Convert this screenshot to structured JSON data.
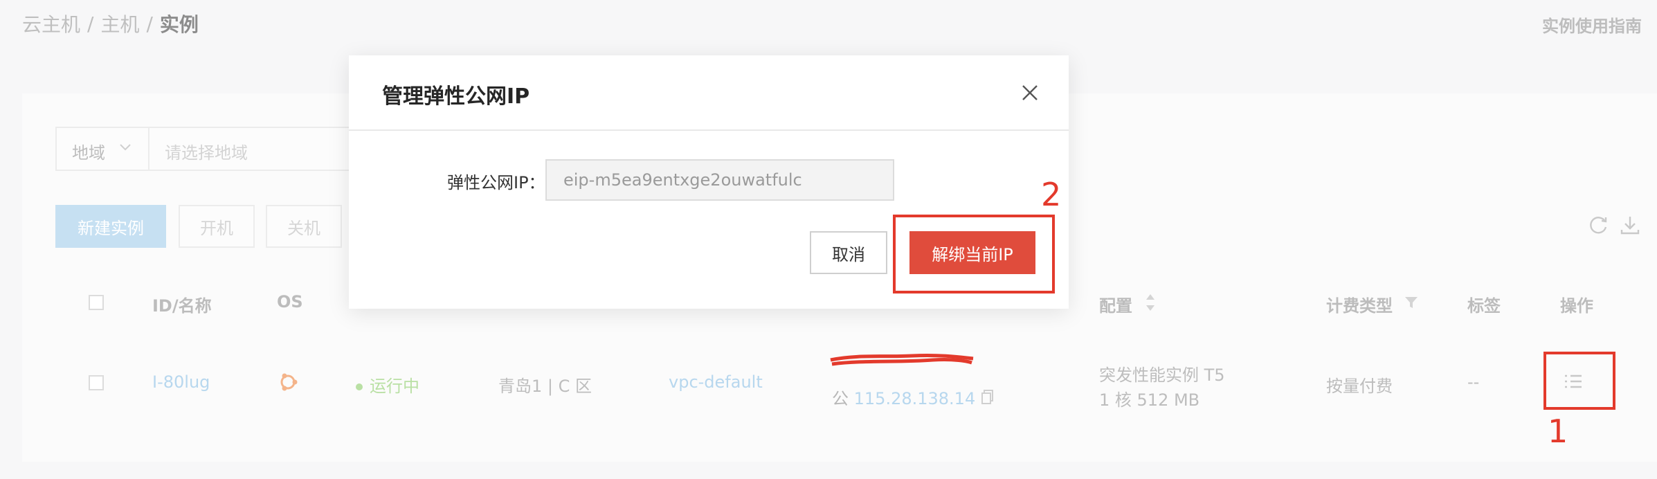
{
  "breadcrumb": {
    "items": [
      "云主机",
      "主机"
    ],
    "separator": "/",
    "current": "实例"
  },
  "header": {
    "guide_link": "实例使用指南"
  },
  "filter": {
    "region_label": "地域",
    "region_placeholder": "请选择地域"
  },
  "toolbar": {
    "new_instance": "新建实例",
    "power_on": "开机",
    "power_off": "关机",
    "refresh_icon": "refresh-icon",
    "download_icon": "download-icon"
  },
  "table": {
    "headers": {
      "id_name": "ID/名称",
      "os": "OS",
      "config": "配置",
      "billing": "计费类型",
      "tags": "标签",
      "actions": "操作"
    },
    "row": {
      "id": "I-80lug",
      "os_icon": "ubuntu-icon",
      "status": "运行中",
      "zone": "青岛1 | C 区",
      "vpc": "vpc-default",
      "public_ip_prefix": "公",
      "public_ip": "115.28.138.14",
      "config_line1": "突发性能实例 T5",
      "config_line2": "1 核 512 MB",
      "billing": "按量付费",
      "tags": "--",
      "action_icon": "list-menu-icon"
    }
  },
  "modal": {
    "title": "管理弹性公网IP",
    "field_label": "弹性公网IP：",
    "field_value": "eip-m5ea9entxge2ouwatfulc",
    "cancel": "取消",
    "unbind": "解绑当前IP"
  },
  "annotations": {
    "step1": "1",
    "step2": "2",
    "color": "#e33a2c"
  },
  "colors": {
    "primary": "#e04c3c",
    "link": "#b7d7ee",
    "status_ok": "#b9e0a4"
  }
}
